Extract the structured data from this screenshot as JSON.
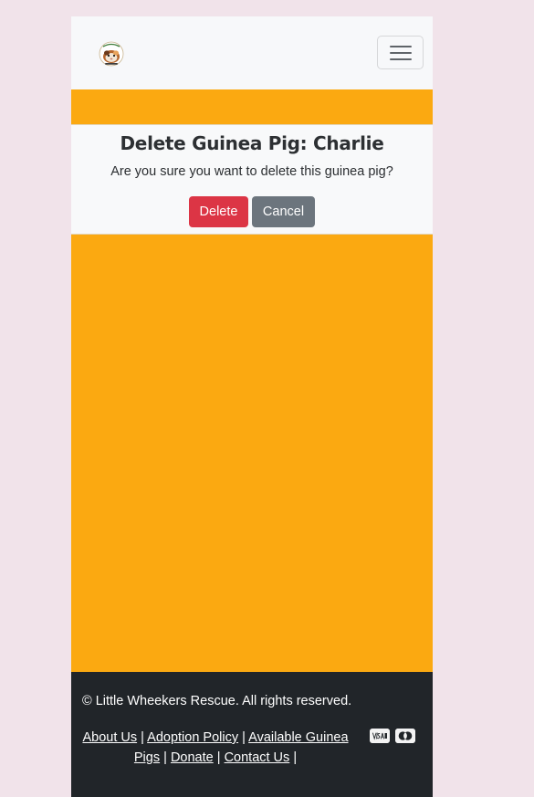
{
  "colors": {
    "page_background": "#f1e3ea",
    "main_background": "#fba911",
    "navbar_background": "#f7f8fa",
    "delete_button": "#dc3545",
    "cancel_button": "#6c757d",
    "footer_background": "#212529"
  },
  "navbar": {
    "logo_icon": "guinea-pig-logo-icon",
    "toggler_icon": "hamburger-menu-icon"
  },
  "dialog": {
    "title": "Delete Guinea Pig: Charlie",
    "message": "Are you sure you want to delete this guinea pig?",
    "delete_label": "Delete",
    "cancel_label": "Cancel"
  },
  "footer": {
    "copyright": "© Little Wheekers Rescue. All rights reserved.",
    "links": [
      {
        "label": "About Us"
      },
      {
        "label": "Adoption Policy"
      },
      {
        "label": "Available Guinea Pigs"
      },
      {
        "label": "Donate"
      },
      {
        "label": "Contact Us"
      }
    ],
    "separator": "|",
    "payment_icons": [
      "visa-icon",
      "mastercard-icon"
    ]
  }
}
